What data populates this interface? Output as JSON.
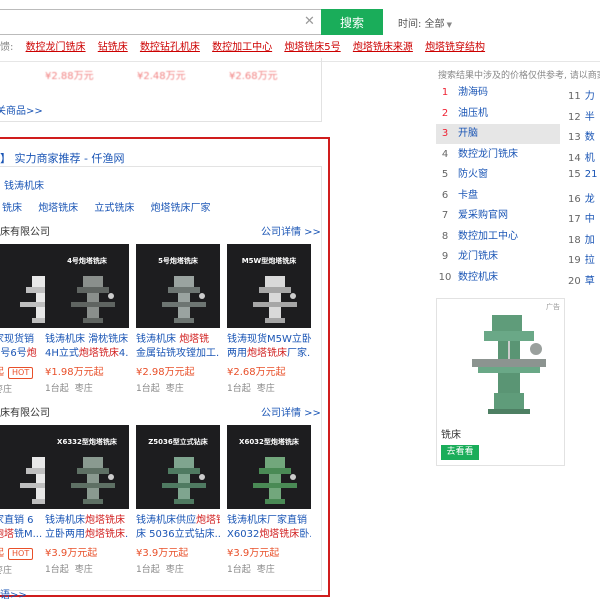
{
  "search": {
    "button_label": "搜索",
    "clear_icon": "close-icon",
    "time_label": "时间: 全部"
  },
  "feedback": {
    "label": "反馈:",
    "terms": [
      "数控龙门铣床",
      "钻铣床",
      "数控钻孔机床",
      "数控加工中心",
      "炮塔铣床5号",
      "炮塔铣床来源",
      "炮塔铣穿结构"
    ]
  },
  "upper": {
    "more_link": "关商品>>",
    "prices": [
      "¥2.88万元",
      "¥2.48万元",
      "¥2.68万元"
    ]
  },
  "merchant": {
    "title_bracket": "】",
    "title": "实力商家推荐 - 仟渔网",
    "main_category": "钱涛机床",
    "categories": [
      "铣床",
      "炮塔铣床",
      "立式铣床",
      "炮塔铣床厂家"
    ],
    "groups": [
      {
        "company": "床有限公司",
        "detail_link": "公司详情 >>",
        "products": [
          {
            "model": "",
            "name_a": "家现货销",
            "name_hl": "",
            "name_b": "",
            "name2_a": "5号6号",
            "name2_hl": "炮",
            "name2_b": "",
            "price": "起",
            "hot": "HOT",
            "moq": "",
            "area": "枣庄"
          },
          {
            "model": "4号炮塔铣床",
            "name_a": "钱涛机床 滑枕铣床",
            "name_hl": "",
            "name_b": "",
            "name2_a": "4H立式",
            "name2_hl": "炮塔铣床",
            "name2_b": "4...",
            "price": "¥1.98万元起",
            "hot": "",
            "moq": "1台起",
            "area": "枣庄"
          },
          {
            "model": "5号炮塔铣床",
            "name_a": "钱涛机床 ",
            "name_hl": "炮塔铣",
            "name_b": "",
            "name2_a": "金属钻铣攻镗加工...",
            "name2_hl": "",
            "name2_b": "",
            "price": "¥2.98万元起",
            "hot": "",
            "moq": "1台起",
            "area": "枣庄"
          },
          {
            "model": "M5W型炮塔铣床",
            "name_a": "钱涛现货M5W立卧",
            "name_hl": "",
            "name_b": "",
            "name2_a": "两用",
            "name2_hl": "炮塔铣床",
            "name2_b": "厂家...",
            "price": "¥2.68万元起",
            "hot": "",
            "moq": "1台起",
            "area": "枣庄"
          }
        ]
      },
      {
        "company": "床有限公司",
        "detail_link": "公司详情 >>",
        "products": [
          {
            "model": "",
            "name_a": "家直销 6",
            "name_hl": "",
            "name_b": "",
            "name2_a": "",
            "name2_hl": "炮塔",
            "name2_b": "铣M...",
            "price": "起",
            "hot": "HOT",
            "moq": "",
            "area": "枣庄"
          },
          {
            "model": "X6332型炮塔铣床",
            "name_a": "钱涛机床",
            "name_hl": "炮塔铣床",
            "name_b": "",
            "name2_a": "立卧两用",
            "name2_hl": "炮塔铣床",
            "name2_b": "...",
            "price": "¥3.9万元起",
            "hot": "",
            "moq": "1台起",
            "area": "枣庄"
          },
          {
            "model": "Z5036型立式钻床",
            "name_a": "钱涛机床供应",
            "name_hl": "炮塔铣",
            "name_b": "",
            "name2_a": "床 5036立式钻床...",
            "name2_hl": "",
            "name2_b": "",
            "price": "¥3.9万元起",
            "hot": "",
            "moq": "1台起",
            "area": "枣庄"
          },
          {
            "model": "X6032型炮塔铣床",
            "name_a": "钱涛机床厂家直销",
            "name_hl": "",
            "name_b": "",
            "name2_a": "X6032",
            "name2_hl": "炮塔铣床",
            "name2_b": "卧...",
            "price": "¥3.9万元起",
            "hot": "",
            "moq": "1台起",
            "area": "枣庄"
          }
        ]
      }
    ],
    "bottom_more": "语>>"
  },
  "right": {
    "note": "搜索结果中涉及的价格仅供参考, 请以商家官",
    "ranks": [
      {
        "num": "1",
        "label": "渤海码"
      },
      {
        "num": "2",
        "label": "油压机"
      },
      {
        "num": "3",
        "label": "开脑"
      },
      {
        "num": "4",
        "label": "数控龙门铣床"
      },
      {
        "num": "5",
        "label": "防火窗"
      },
      {
        "num": "6",
        "label": "卡盘"
      },
      {
        "num": "7",
        "label": "爱采购官网"
      },
      {
        "num": "8",
        "label": "数控加工中心"
      },
      {
        "num": "9",
        "label": "龙门铣床"
      },
      {
        "num": "10",
        "label": "数控机床"
      }
    ],
    "ranks2": [
      {
        "num": "11",
        "label": "力"
      },
      {
        "num": "12",
        "label": "半"
      },
      {
        "num": "13",
        "label": "数"
      },
      {
        "num": "14",
        "label": "机"
      },
      {
        "num": "15",
        "label": "21"
      },
      {
        "num": "16",
        "label": "龙"
      },
      {
        "num": "17",
        "label": "中"
      },
      {
        "num": "18",
        "label": "加"
      },
      {
        "num": "19",
        "label": "拉"
      },
      {
        "num": "20",
        "label": "草"
      }
    ],
    "ad": {
      "tag": "广告",
      "title": "铣床",
      "button": "去看看"
    }
  }
}
